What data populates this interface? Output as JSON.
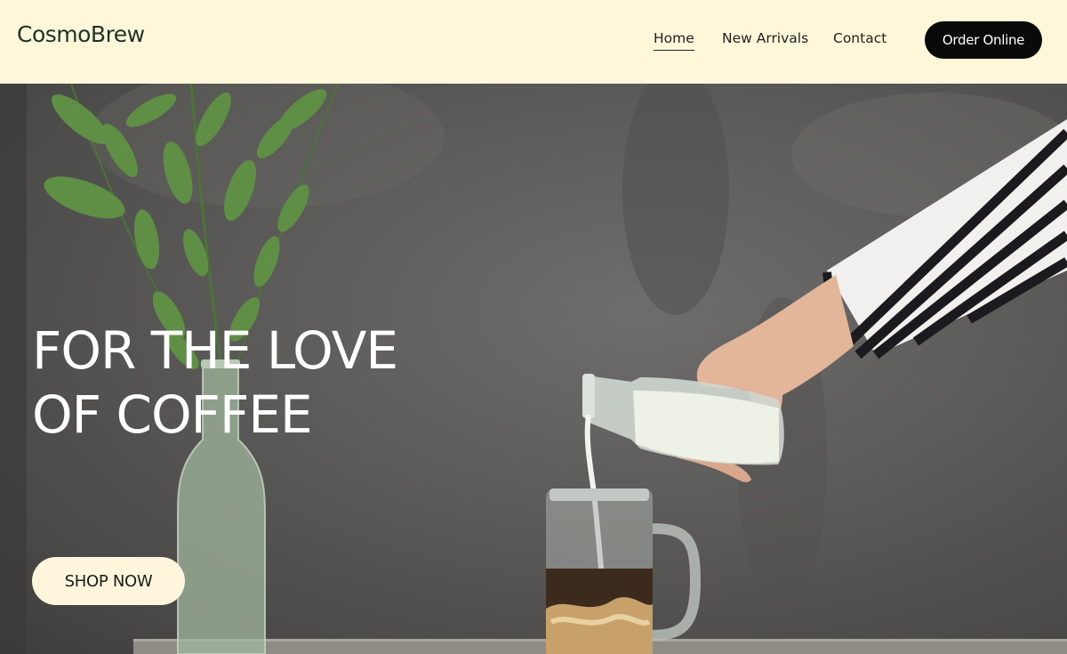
{
  "header": {
    "logo": "CosmoBrew",
    "nav": [
      {
        "label": "Home",
        "active": true
      },
      {
        "label": "New Arrivals"
      },
      {
        "label": "Contact"
      }
    ],
    "cta_label": "Order Online"
  },
  "hero": {
    "headline_line1": "FOR THE LOVE",
    "headline_line2": "OF COFFEE",
    "button_label": "SHOP NOW",
    "image_description_icon": "milk-pouring-coffee-photo"
  },
  "colors": {
    "header_bg": "#fef7da",
    "logo_text": "#1e3327",
    "cta_bg": "#0a0a0a",
    "button_bg": "#fdf6dc",
    "headline_text": "#ffffff"
  }
}
